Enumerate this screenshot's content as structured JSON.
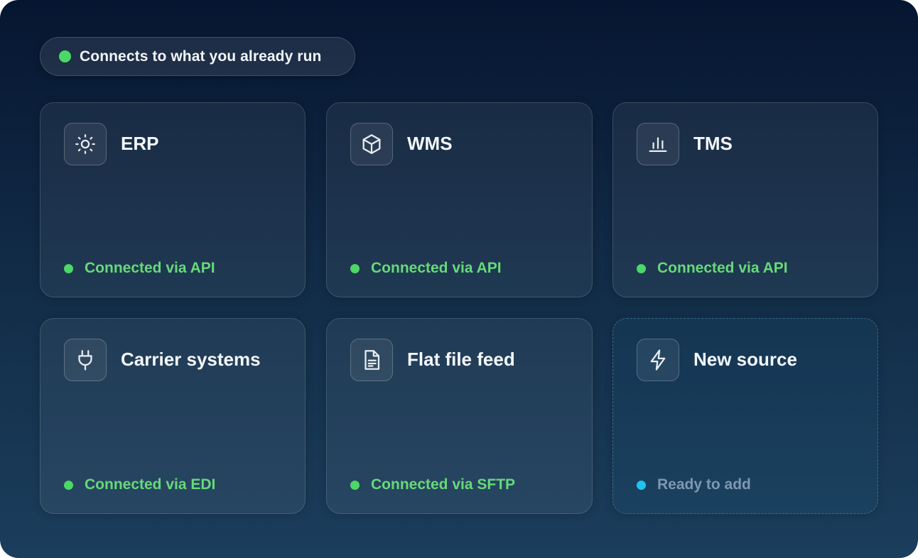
{
  "header": {
    "label": "Connects to what you already run",
    "dot_color": "#4bd866"
  },
  "colors": {
    "connected": "#67d97a",
    "connected_dot": "#4bd866",
    "pending_dot": "#1ec3ee",
    "pending_text": "#7f98b0"
  },
  "cards": [
    {
      "title": "ERP",
      "icon": "sun-icon",
      "status": "Connected via API",
      "state": "connected"
    },
    {
      "title": "WMS",
      "icon": "box-icon",
      "status": "Connected via API",
      "state": "connected"
    },
    {
      "title": "TMS",
      "icon": "bar-chart-icon",
      "status": "Connected via API",
      "state": "connected"
    },
    {
      "title": "Carrier systems",
      "icon": "plug-icon",
      "status": "Connected via EDI",
      "state": "connected"
    },
    {
      "title": "Flat file feed",
      "icon": "file-text-icon",
      "status": "Connected via SFTP",
      "state": "connected"
    },
    {
      "title": "New source",
      "icon": "lightning-icon",
      "status": "Ready to add",
      "state": "pending"
    }
  ]
}
